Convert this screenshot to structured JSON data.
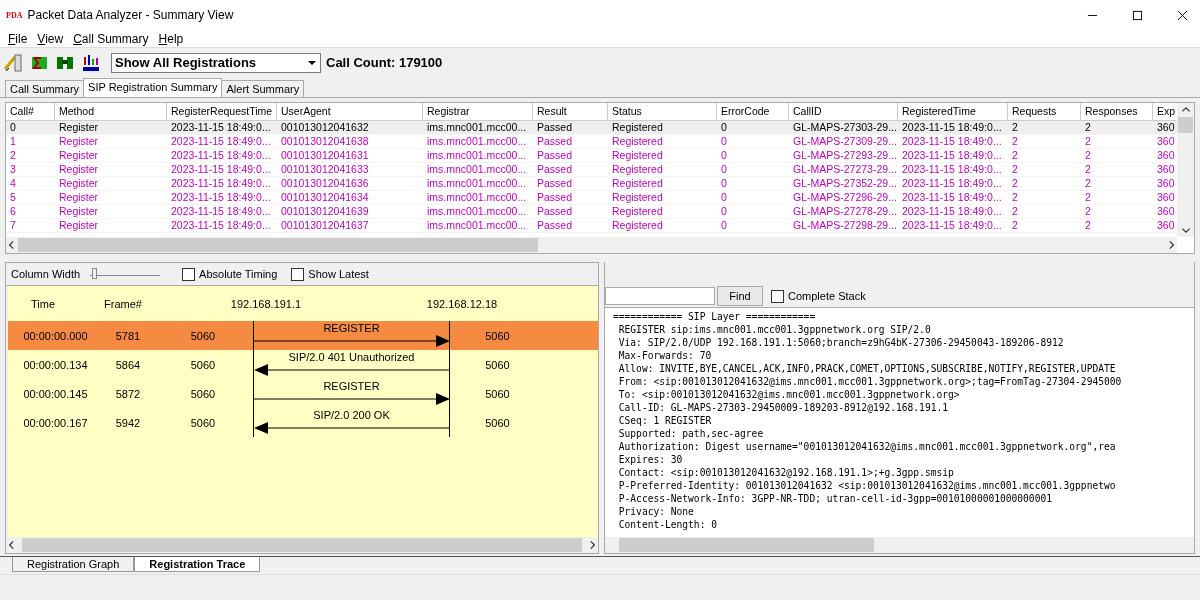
{
  "window": {
    "logo": "PDA",
    "title": "Packet Data Analyzer - Summary View"
  },
  "menu": [
    "File",
    "View",
    "Call Summary",
    "Help"
  ],
  "toolbar": {
    "filter": "Show All Registrations",
    "call_count": "Call Count: 179100"
  },
  "summary_tabs": [
    {
      "label": "Call Summary",
      "selected": false
    },
    {
      "label": "SIP Registration Summary",
      "selected": true
    },
    {
      "label": "Alert Summary",
      "selected": false
    }
  ],
  "table": {
    "columns": [
      "Call#",
      "Method",
      "RegisterRequestTime",
      "UserAgent",
      "Registrar",
      "Result",
      "Status",
      "ErrorCode",
      "CallID",
      "RegisteredTime",
      "Requests",
      "Responses",
      "Exp"
    ],
    "rows": [
      {
        "selected": true,
        "cells": [
          "0",
          "Register",
          "2023-11-15 18:49:0...",
          "001013012041632",
          "ims.mnc001.mcc00...",
          "Passed",
          "Registered",
          "0",
          "GL-MAPS-27303-29...",
          "2023-11-15 18:49:0...",
          "2",
          "2",
          "360"
        ]
      },
      {
        "selected": false,
        "cells": [
          "1",
          "Register",
          "2023-11-15 18:49:0...",
          "001013012041638",
          "ims.mnc001.mcc00...",
          "Passed",
          "Registered",
          "0",
          "GL-MAPS-27309-29...",
          "2023-11-15 18:49:0...",
          "2",
          "2",
          "360"
        ]
      },
      {
        "selected": false,
        "cells": [
          "2",
          "Register",
          "2023-11-15 18:49:0...",
          "001013012041631",
          "ims.mnc001.mcc00...",
          "Passed",
          "Registered",
          "0",
          "GL-MAPS-27293-29...",
          "2023-11-15 18:49:0...",
          "2",
          "2",
          "360"
        ]
      },
      {
        "selected": false,
        "cells": [
          "3",
          "Register",
          "2023-11-15 18:49:0...",
          "001013012041633",
          "ims.mnc001.mcc00...",
          "Passed",
          "Registered",
          "0",
          "GL-MAPS-27273-29...",
          "2023-11-15 18:49:0...",
          "2",
          "2",
          "360"
        ]
      },
      {
        "selected": false,
        "cells": [
          "4",
          "Register",
          "2023-11-15 18:49:0...",
          "001013012041636",
          "ims.mnc001.mcc00...",
          "Passed",
          "Registered",
          "0",
          "GL-MAPS-27352-29...",
          "2023-11-15 18:49:0...",
          "2",
          "2",
          "360"
        ]
      },
      {
        "selected": false,
        "cells": [
          "5",
          "Register",
          "2023-11-15 18:49:0...",
          "001013012041634",
          "ims.mnc001.mcc00...",
          "Passed",
          "Registered",
          "0",
          "GL-MAPS-27296-29...",
          "2023-11-15 18:49:0...",
          "2",
          "2",
          "360"
        ]
      },
      {
        "selected": false,
        "cells": [
          "6",
          "Register",
          "2023-11-15 18:49:0...",
          "001013012041639",
          "ims.mnc001.mcc00...",
          "Passed",
          "Registered",
          "0",
          "GL-MAPS-27278-29...",
          "2023-11-15 18:49:0...",
          "2",
          "2",
          "360"
        ]
      },
      {
        "selected": false,
        "cells": [
          "7",
          "Register",
          "2023-11-15 18:49:0...",
          "001013012041637",
          "ims.mnc001.mcc00...",
          "Passed",
          "Registered",
          "0",
          "GL-MAPS-27298-29...",
          "2023-11-15 18:49:0...",
          "2",
          "2",
          "360"
        ]
      }
    ]
  },
  "trace_controls": {
    "column_width_label": "Column Width",
    "column_width": {
      "level": 0.03
    },
    "checkboxes": [
      {
        "label": "Absolute Timing",
        "checked": false
      },
      {
        "label": "Show Latest",
        "checked": false
      }
    ]
  },
  "ladder": {
    "headers": [
      "Time",
      "Frame#"
    ],
    "hosts": [
      "192.168.191.1",
      "192.168.12.18"
    ],
    "messages": [
      {
        "time": "00:00:00.000",
        "frame": "5781",
        "src_port": "5060",
        "label": "REGISTER",
        "kind": "request",
        "dst_port": "5060",
        "selected": true
      },
      {
        "time": "00:00:00.134",
        "frame": "5864",
        "src_port": "5060",
        "label": "SIP/2.0 401 Unauthorized",
        "kind": "response",
        "dst_port": "5060",
        "selected": false
      },
      {
        "time": "00:00:00.145",
        "frame": "5872",
        "src_port": "5060",
        "label": "REGISTER",
        "kind": "request",
        "dst_port": "5060",
        "selected": false
      },
      {
        "time": "00:00:00.167",
        "frame": "5942",
        "src_port": "5060",
        "label": "SIP/2.0 200 OK",
        "kind": "response",
        "dst_port": "5060",
        "selected": false
      }
    ]
  },
  "detail": {
    "find_button": "Find",
    "complete_stack": {
      "label": "Complete Stack",
      "checked": false
    },
    "lines": [
      "============ SIP Layer ============",
      " REGISTER sip:ims.mnc001.mcc001.3gppnetwork.org SIP/2.0",
      " Via: SIP/2.0/UDP 192.168.191.1:5060;branch=z9hG4bK-27306-29450043-189206-8912",
      " Max-Forwards: 70",
      " Allow: INVITE,BYE,CANCEL,ACK,INFO,PRACK,COMET,OPTIONS,SUBSCRIBE,NOTIFY,REGISTER,UPDATE",
      " From: <sip:001013012041632@ims.mnc001.mcc001.3gppnetwork.org>;tag=FromTag-27304-2945000",
      " To: <sip:001013012041632@ims.mnc001.mcc001.3gppnetwork.org>",
      " Call-ID: GL-MAPS-27303-29450009-189203-8912@192.168.191.1",
      " CSeq: 1 REGISTER",
      " Supported: path,sec-agree",
      " Authorization: Digest username=\"001013012041632@ims.mnc001.mcc001.3gppnetwork.org\",rea",
      " Expires: 30",
      " Contact: <sip:001013012041632@192.168.191.1>;+g.3gpp.smsip",
      " P-Preferred-Identity: 001013012041632 <sip:001013012041632@ims.mnc001.mcc001.3gppnetwo",
      " P-Access-Network-Info: 3GPP-NR-TDD; utran-cell-id-3gpp=00101000001000000001",
      " Privacy: None",
      " Content-Length: 0"
    ]
  },
  "bottom_tabs": [
    {
      "label": "Registration Graph",
      "selected": false
    },
    {
      "label": "Registration Trace",
      "selected": true
    }
  ]
}
